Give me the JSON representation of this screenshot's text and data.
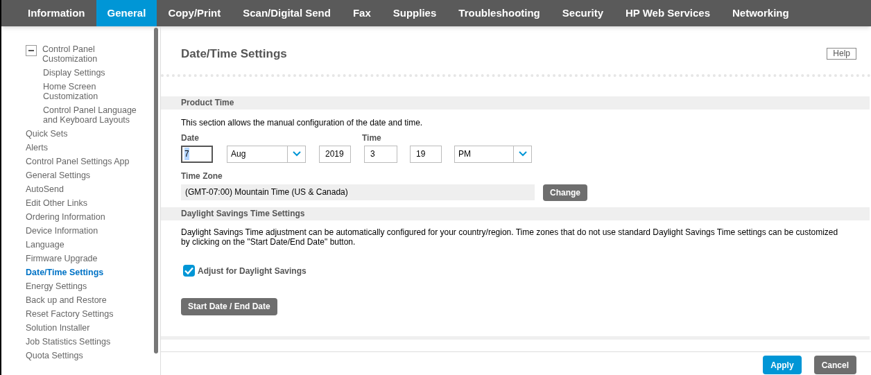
{
  "nav": {
    "tabs": [
      {
        "label": "Information",
        "selected": false
      },
      {
        "label": "General",
        "selected": true
      },
      {
        "label": "Copy/Print",
        "selected": false
      },
      {
        "label": "Scan/Digital Send",
        "selected": false
      },
      {
        "label": "Fax",
        "selected": false
      },
      {
        "label": "Supplies",
        "selected": false
      },
      {
        "label": "Troubleshooting",
        "selected": false
      },
      {
        "label": "Security",
        "selected": false
      },
      {
        "label": "HP Web Services",
        "selected": false
      },
      {
        "label": "Networking",
        "selected": false
      }
    ]
  },
  "sidebar": {
    "items": [
      {
        "label": "Control Panel Customization",
        "selected": false,
        "expanded": true,
        "children": [
          {
            "label": "Display Settings",
            "selected": false
          },
          {
            "label": "Home Screen Customization",
            "selected": false
          },
          {
            "label": "Control Panel Language and Keyboard Layouts",
            "selected": false
          }
        ]
      },
      {
        "label": "Quick Sets",
        "selected": false
      },
      {
        "label": "Alerts",
        "selected": false
      },
      {
        "label": "Control Panel Settings App",
        "selected": false
      },
      {
        "label": "General Settings",
        "selected": false
      },
      {
        "label": "AutoSend",
        "selected": false
      },
      {
        "label": "Edit Other Links",
        "selected": false
      },
      {
        "label": "Ordering Information",
        "selected": false
      },
      {
        "label": "Device Information",
        "selected": false
      },
      {
        "label": "Language",
        "selected": false
      },
      {
        "label": "Firmware Upgrade",
        "selected": false
      },
      {
        "label": "Date/Time Settings",
        "selected": true
      },
      {
        "label": "Energy Settings",
        "selected": false
      },
      {
        "label": "Back up and Restore",
        "selected": false
      },
      {
        "label": "Reset Factory Settings",
        "selected": false
      },
      {
        "label": "Solution Installer",
        "selected": false
      },
      {
        "label": "Job Statistics Settings",
        "selected": false
      },
      {
        "label": "Quota Settings",
        "selected": false
      }
    ]
  },
  "page": {
    "title": "Date/Time Settings",
    "help_button": "Help",
    "product_time": {
      "heading": "Product Time",
      "description": "This section allows the manual configuration of the date and time.",
      "date_label": "Date",
      "time_label": "Time",
      "fields": [
        {
          "kind": "input",
          "value": "7",
          "focused": true
        },
        {
          "kind": "select",
          "value": "Aug",
          "focused": false
        },
        {
          "kind": "input",
          "value": "2019",
          "focused": false
        },
        {
          "kind": "input",
          "value": "3",
          "focused": false
        },
        {
          "kind": "input",
          "value": "19",
          "focused": false
        },
        {
          "kind": "select",
          "value": "PM",
          "focused": false
        }
      ],
      "time_zone_label": "Time Zone",
      "time_zone": "(GMT-07:00) Mountain Time (US & Canada)",
      "change_button": "Change"
    },
    "dst": {
      "heading": "Daylight Savings Time Settings",
      "description": "Daylight Savings Time adjustment can be automatically configured for your country/region. Time zones that do not use standard Daylight Savings Time settings can be customized by clicking on the \"Start Date/End Date\" button.",
      "checkbox": {
        "label": "Adjust for Daylight Savings",
        "checked": true
      },
      "button": "Start Date / End Date"
    },
    "footer": {
      "buttons": [
        {
          "label": "Apply",
          "kind": "primary"
        },
        {
          "label": "Cancel",
          "kind": "secondary"
        }
      ]
    }
  }
}
